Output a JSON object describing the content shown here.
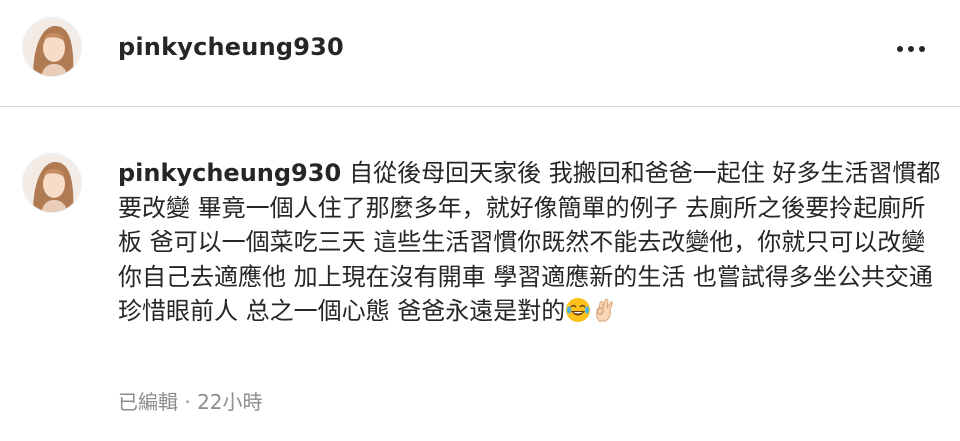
{
  "header": {
    "username": "pinkycheung930",
    "more_icon": "more-horizontal-icon"
  },
  "comment": {
    "username": "pinkycheung930",
    "text": "自從後母回天家後 我搬回和爸爸一起住 好多生活習慣都要改變 畢竟一個人住了那麼多年，就好像簡單的例子 去廁所之後要拎起廁所板 爸可以一個菜吃三天 這些生活習慣你既然不能去改變他，你就只可以改變你自己去適應他 加上現在沒有開車 學習適應新的生活 也嘗試得多坐公共交通 珍惜眼前人 总之一個心態 爸爸永遠是對的",
    "emojis": [
      "joy-emoji",
      "ok-hand-emoji"
    ],
    "meta": "已編輯 · 22小時"
  },
  "colors": {
    "text": "#262626",
    "secondary": "#8e8e8e",
    "divider": "#dbdbdb"
  }
}
